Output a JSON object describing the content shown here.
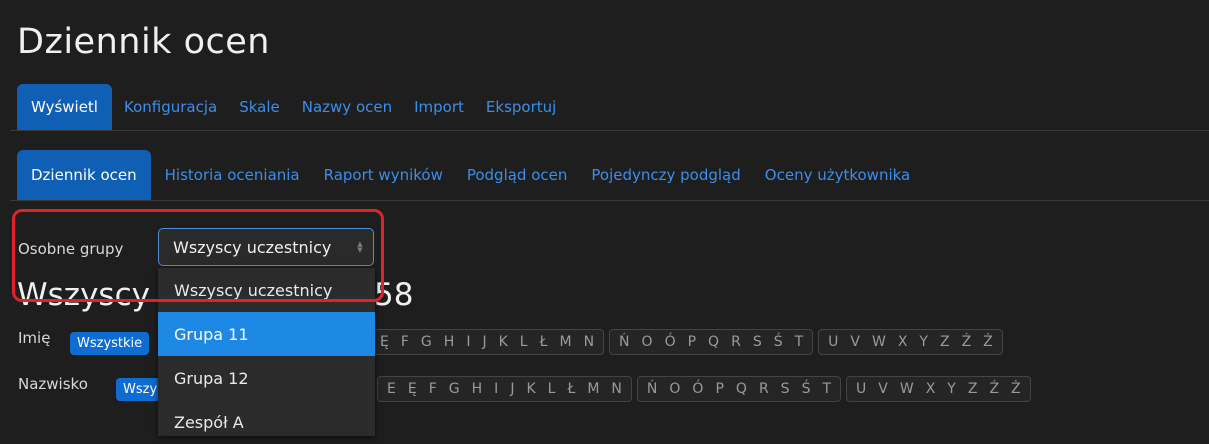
{
  "page": {
    "title": "Dziennik ocen"
  },
  "tabs_top": [
    {
      "label": "Wyświetl",
      "active": true
    },
    {
      "label": "Konfiguracja",
      "active": false
    },
    {
      "label": "Skale",
      "active": false
    },
    {
      "label": "Nazwy ocen",
      "active": false
    },
    {
      "label": "Import",
      "active": false
    },
    {
      "label": "Eksportuj",
      "active": false
    }
  ],
  "tabs_sub": [
    {
      "label": "Dziennik ocen",
      "active": true
    },
    {
      "label": "Historia oceniania",
      "active": false
    },
    {
      "label": "Raport wyników",
      "active": false
    },
    {
      "label": "Podgląd ocen",
      "active": false
    },
    {
      "label": "Pojedynczy podgląd",
      "active": false
    },
    {
      "label": "Oceny użytkownika",
      "active": false
    }
  ],
  "groups": {
    "label": "Osobne grupy",
    "selected": "Wszyscy uczestnicy",
    "options": [
      {
        "label": "Wszyscy uczestnicy",
        "highlighted": false
      },
      {
        "label": "Grupa 11",
        "highlighted": true
      },
      {
        "label": "Grupa 12",
        "highlighted": false
      },
      {
        "label": "Zespół A",
        "highlighted": false
      }
    ]
  },
  "heading": {
    "visible_start": "Wszyscy u",
    "visible_end": "58"
  },
  "filters": {
    "firstname": {
      "label": "Imię",
      "all": "Wszystkie",
      "letter_groups": [
        [
          "Ę",
          "F",
          "G",
          "H",
          "I",
          "J",
          "K",
          "L",
          "Ł",
          "M",
          "N"
        ],
        [
          "Ń",
          "O",
          "Ó",
          "P",
          "Q",
          "R",
          "S",
          "Ś",
          "T"
        ],
        [
          "U",
          "V",
          "W",
          "X",
          "Y",
          "Z",
          "Ź",
          "Ż"
        ]
      ]
    },
    "lastname": {
      "label": "Nazwisko",
      "all": "Wszy",
      "letter_groups": [
        [
          "E",
          "Ę",
          "F",
          "G",
          "H",
          "I",
          "J",
          "K",
          "L",
          "Ł",
          "M",
          "N"
        ],
        [
          "Ń",
          "O",
          "Ó",
          "P",
          "Q",
          "R",
          "S",
          "Ś",
          "T"
        ],
        [
          "U",
          "V",
          "W",
          "X",
          "Y",
          "Z",
          "Ź",
          "Ż"
        ]
      ]
    }
  },
  "colors": {
    "accent": "#0f5fb5",
    "link": "#3b8eea",
    "highlight_box": "#e0222a",
    "dropdown_selected": "#1e88e5"
  }
}
